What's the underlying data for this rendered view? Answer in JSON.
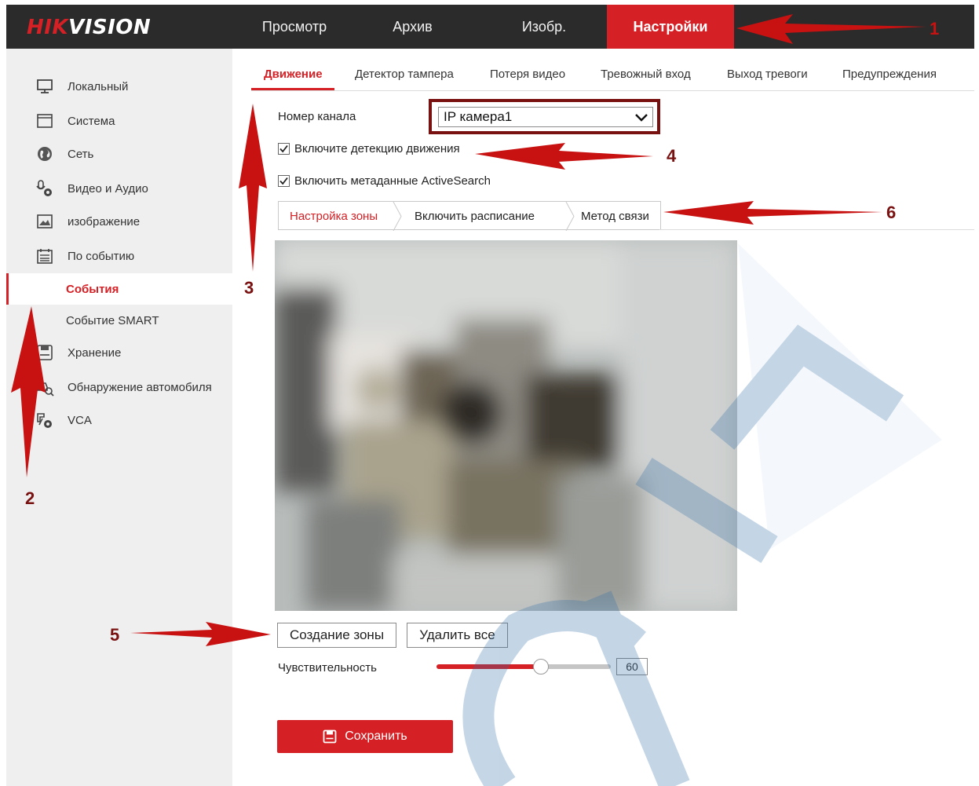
{
  "brand": {
    "logo_hik": "HIK",
    "logo_vision": "VISION"
  },
  "topnav": {
    "items": [
      {
        "label": "Просмотр"
      },
      {
        "label": "Архив"
      },
      {
        "label": "Изобр."
      },
      {
        "label": "Настройки",
        "active": true
      }
    ]
  },
  "sidebar": {
    "items": [
      {
        "label": "Локальный",
        "icon": "monitor-icon"
      },
      {
        "label": "Система",
        "icon": "window-icon"
      },
      {
        "label": "Сеть",
        "icon": "globe-icon"
      },
      {
        "label": "Видео и Аудио",
        "icon": "mic-gear-icon"
      },
      {
        "label": "изображение",
        "icon": "image-icon"
      },
      {
        "label": "По событию",
        "icon": "calendar-icon"
      }
    ],
    "subitems": [
      {
        "label": "События",
        "active": true
      },
      {
        "label": "Событие SMART"
      }
    ],
    "items2": [
      {
        "label": "Хранение",
        "icon": "disk-icon"
      },
      {
        "label": "Обнаружение автомобиля",
        "icon": "car-search-icon"
      },
      {
        "label": "VCA",
        "icon": "vca-icon"
      }
    ]
  },
  "tabs": [
    {
      "label": "Движение",
      "active": true
    },
    {
      "label": "Детектор тампера"
    },
    {
      "label": "Потеря видео"
    },
    {
      "label": "Тревожный вход"
    },
    {
      "label": "Выход тревоги"
    },
    {
      "label": "Предупреждения"
    }
  ],
  "form": {
    "channel_label": "Номер канала",
    "channel_value": "IP камера1",
    "enable_motion_label": "Включите детекцию движения",
    "enable_motion_checked": true,
    "enable_meta_label": "Включить метаданные ActiveSearch",
    "enable_meta_checked": true
  },
  "subtabs": [
    {
      "label": "Настройка зоны",
      "active": true
    },
    {
      "label": "Включить расписание"
    },
    {
      "label": "Метод связи"
    }
  ],
  "actions": {
    "create_zone": "Создание зоны",
    "delete_all": "Удалить все",
    "sensitivity_label": "Чувствительность",
    "sensitivity_value": "60",
    "sensitivity_level": 0.6,
    "save": "Сохранить"
  },
  "annotations": [
    "1",
    "2",
    "3",
    "4",
    "5",
    "6"
  ],
  "colors": {
    "accent": "#d52025",
    "topbar": "#2b2b2b",
    "sidebar": "#efefef",
    "annotation": "#7a1111"
  }
}
